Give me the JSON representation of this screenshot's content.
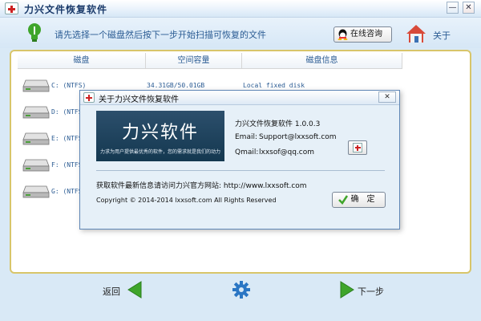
{
  "window": {
    "title": "力兴文件恢复软件",
    "minimize_glyph": "—",
    "close_glyph": "✕"
  },
  "hint_bar": {
    "text": "请先选择一个磁盘然后按下一步开始扫描可恢复的文件",
    "online_button": "在线咨询",
    "about_label": "关于"
  },
  "drive_table": {
    "columns": [
      "磁盘",
      "空间容量",
      "磁盘信息"
    ],
    "rows": [
      {
        "name": "C: (NTFS)",
        "capacity": "34.31GB/50.01GB",
        "info": "Local fixed disk"
      },
      {
        "name": "D: (NTFS",
        "capacity": "",
        "info": ""
      },
      {
        "name": "E: (NTFS",
        "capacity": "",
        "info": ""
      },
      {
        "name": "F: (NTFS",
        "capacity": "",
        "info": ""
      },
      {
        "name": "G: (NTFS",
        "capacity": "",
        "info": ""
      }
    ]
  },
  "nav": {
    "back_label": "返回",
    "next_label": "下一步"
  },
  "about_dialog": {
    "title": "关于力兴文件恢复软件",
    "close_glyph": "✕",
    "banner_title": "力兴软件",
    "banner_slogan": "力求为用户提供最优秀的软件，您的需求就是我们的动力",
    "product": "力兴文件恢复软件 1.0.0.3",
    "email_label": "Email:",
    "email_value": "Support@lxxsoft.com",
    "qmail_label": "Qmail:",
    "qmail_value": "lxxsof@qq.com",
    "website_text": "获取软件最新信息请访问力兴官方网站: http://www.lxxsoft.com",
    "copyright": "Copyright © 2014-2014 lxxsoft.com All Rights Reserved",
    "ok_button": "确　定"
  },
  "colors": {
    "accent_blue": "#2a5b93",
    "panel_border": "#d8c56a",
    "window_bg": "#d9e9f6",
    "icon_green": "#3fa52b"
  },
  "icons": [
    "app-logo-icon",
    "bulb-icon",
    "qq-icon",
    "home-icon",
    "disk-icon",
    "back-arrow-icon",
    "gear-icon",
    "next-arrow-icon",
    "check-icon"
  ]
}
